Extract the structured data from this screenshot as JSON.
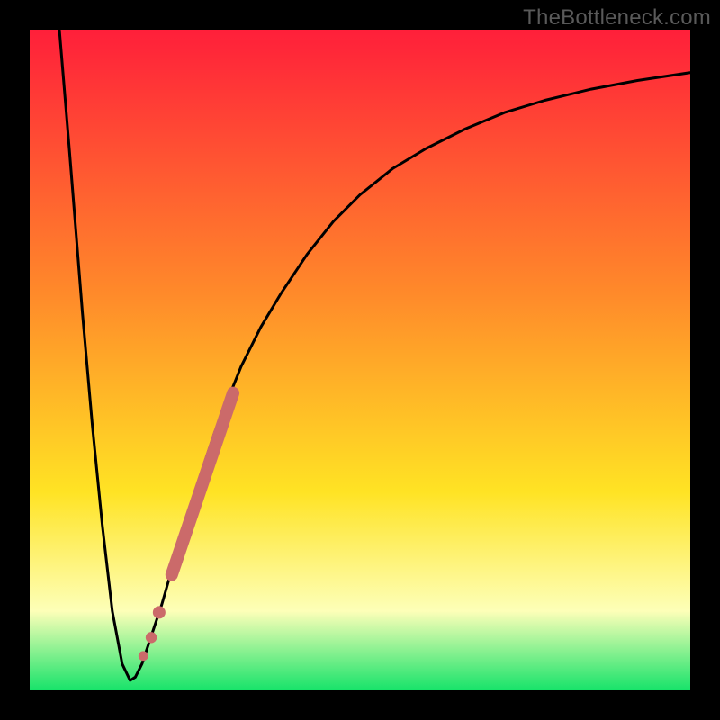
{
  "watermark": "TheBottleneck.com",
  "colors": {
    "gradient_top": "#ff1f3a",
    "gradient_mid1": "#ff8a2a",
    "gradient_mid2": "#ffe324",
    "gradient_pale": "#fdffb8",
    "gradient_bottom": "#17e36a",
    "curve": "#000000",
    "markers": "#cb6a6a",
    "frame": "#000000"
  },
  "chart_data": {
    "type": "line",
    "title": "",
    "xlabel": "",
    "ylabel": "",
    "xlim": [
      0,
      100
    ],
    "ylim": [
      0,
      100
    ],
    "curve": {
      "x": [
        4.5,
        6,
        8,
        9.5,
        11,
        12.5,
        14,
        15.2,
        16,
        17,
        18,
        20,
        22,
        24,
        26,
        28,
        30,
        32,
        35,
        38,
        42,
        46,
        50,
        55,
        60,
        66,
        72,
        78,
        85,
        92,
        100
      ],
      "y": [
        100,
        82,
        57,
        40,
        25,
        12,
        4,
        1.5,
        2,
        4,
        7,
        13,
        20,
        27,
        33,
        39,
        44,
        49,
        55,
        60,
        66,
        71,
        75,
        79,
        82,
        85,
        87.5,
        89.3,
        91,
        92.3,
        93.5
      ]
    },
    "markers": {
      "line_segment": {
        "x1": 21.5,
        "y1": 17.5,
        "x2": 30.8,
        "y2": 45.0
      },
      "dots": [
        {
          "x": 19.6,
          "y": 11.8
        },
        {
          "x": 18.4,
          "y": 8.0
        },
        {
          "x": 17.2,
          "y": 5.2
        }
      ]
    }
  }
}
